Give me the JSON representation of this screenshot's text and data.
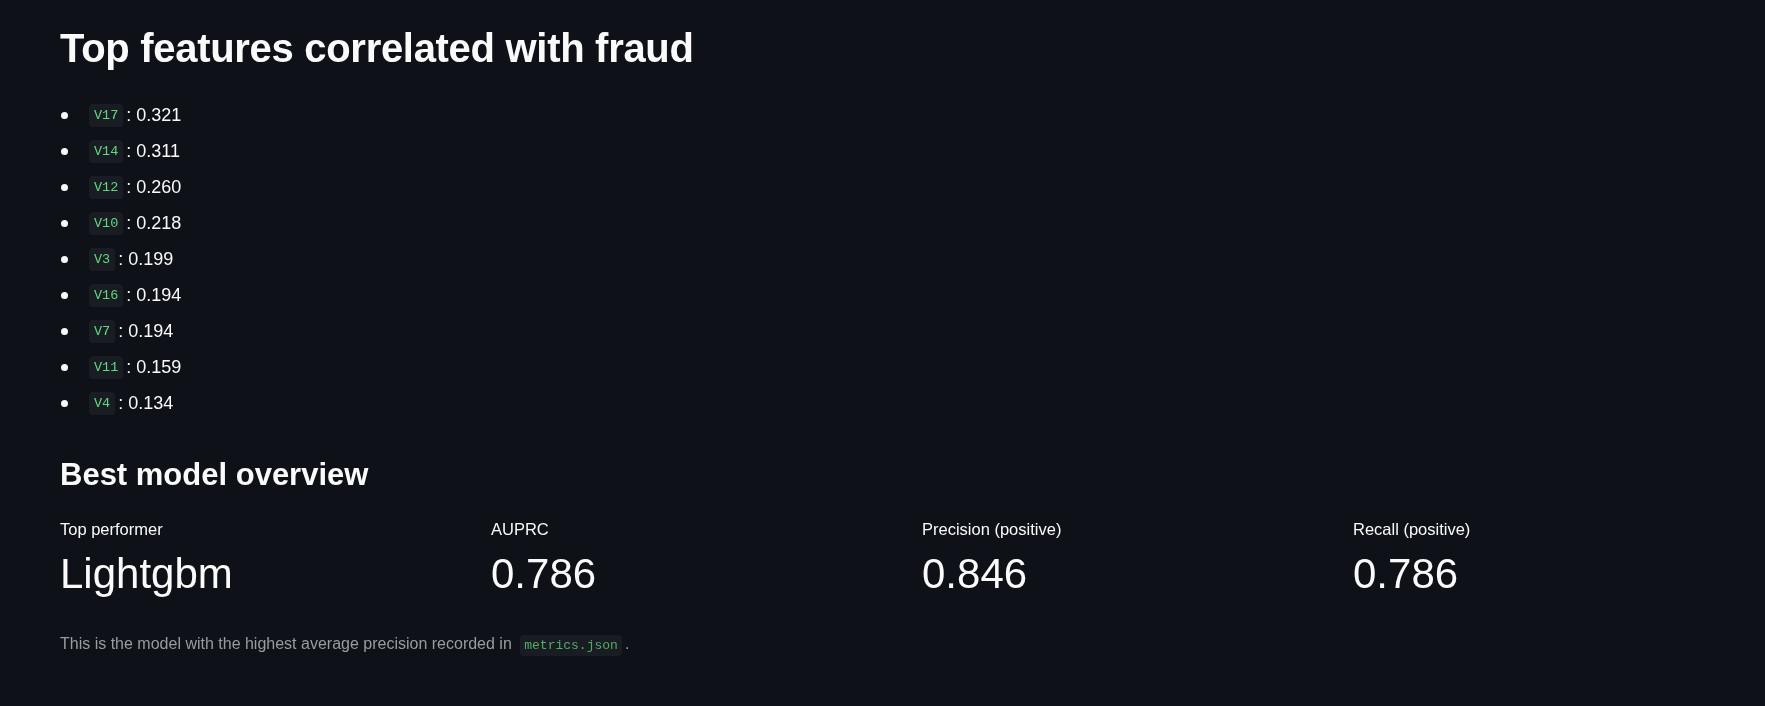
{
  "features_section": {
    "heading": "Top features correlated with fraud",
    "features": [
      {
        "code": "V17",
        "text": ": 0.321"
      },
      {
        "code": "V14",
        "text": ": 0.311"
      },
      {
        "code": "V12",
        "text": ": 0.260"
      },
      {
        "code": "V10",
        "text": ": 0.218"
      },
      {
        "code": "V3",
        "text": ": 0.199"
      },
      {
        "code": "V16",
        "text": ": 0.194"
      },
      {
        "code": "V7",
        "text": ": 0.194"
      },
      {
        "code": "V11",
        "text": ": 0.159"
      },
      {
        "code": "V4",
        "text": ": 0.134"
      }
    ]
  },
  "overview_section": {
    "heading": "Best model overview",
    "metrics": [
      {
        "label": "Top performer",
        "value": "Lightgbm"
      },
      {
        "label": "AUPRC",
        "value": "0.786"
      },
      {
        "label": "Precision (positive)",
        "value": "0.846"
      },
      {
        "label": "Recall (positive)",
        "value": "0.786"
      }
    ],
    "caption": [
      {
        "kind": "text",
        "text": "This is the model with the highest average precision recorded in "
      },
      {
        "kind": "code",
        "text": "metrics.json"
      },
      {
        "kind": "text",
        "text": "."
      }
    ]
  }
}
